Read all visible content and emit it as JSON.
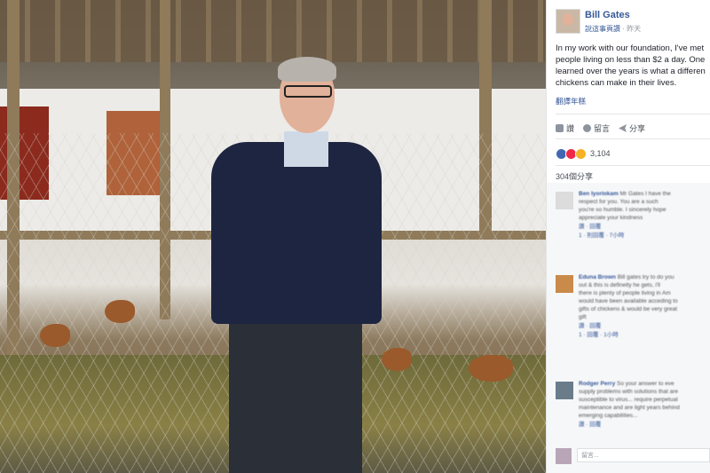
{
  "post": {
    "author": "Bill Gates",
    "page_kind": "說這事頁讚",
    "time": "昨天",
    "text_lines": [
      "In my work with our foundation, I've met",
      "people living on less than $2 a day. One",
      "learned over the years is what a differen",
      "chickens can make in their lives."
    ],
    "translate_label": "翻譯年糕"
  },
  "actions": {
    "like": "讚",
    "comment": "留言",
    "share": "分享"
  },
  "reactions": {
    "count": "3,104"
  },
  "shares_label": "304個分享",
  "comments": [
    {
      "name": "Ben Iyoriokam",
      "lines": [
        "Mr Gates I have the",
        "respect for you. You are a such",
        "you're so humble. I sincerely hope",
        "appreciate your kindness"
      ],
      "action_lines": [
        "讚 · 回覆",
        "1 · 則回覆 · 7小時"
      ],
      "avatar_color": "#dcdcdc"
    },
    {
      "name": "Eduna Brown",
      "lines": [
        "Bill gates try to do you",
        "out & this is definetly he gets, i'll",
        "there is plenty of people living in Am",
        "would have been available acceding to",
        "gifts of chickens & would be very great",
        "gift"
      ],
      "action_lines": [
        "讚 · 回覆",
        "1 · 回覆 · 1小時"
      ],
      "avatar_color": "#c98a4a"
    },
    {
      "name": "Rodger Perry",
      "lines": [
        "So your answer to eve",
        "supply problems with solutions that are",
        "susceptible to virus... require perpetual",
        "maintenance and are light years behind",
        "emerging capabilities..."
      ],
      "action_lines": [
        "讚 · 回覆"
      ],
      "avatar_color": "#6a7c8a"
    }
  ],
  "reply_placeholder": "留言..."
}
